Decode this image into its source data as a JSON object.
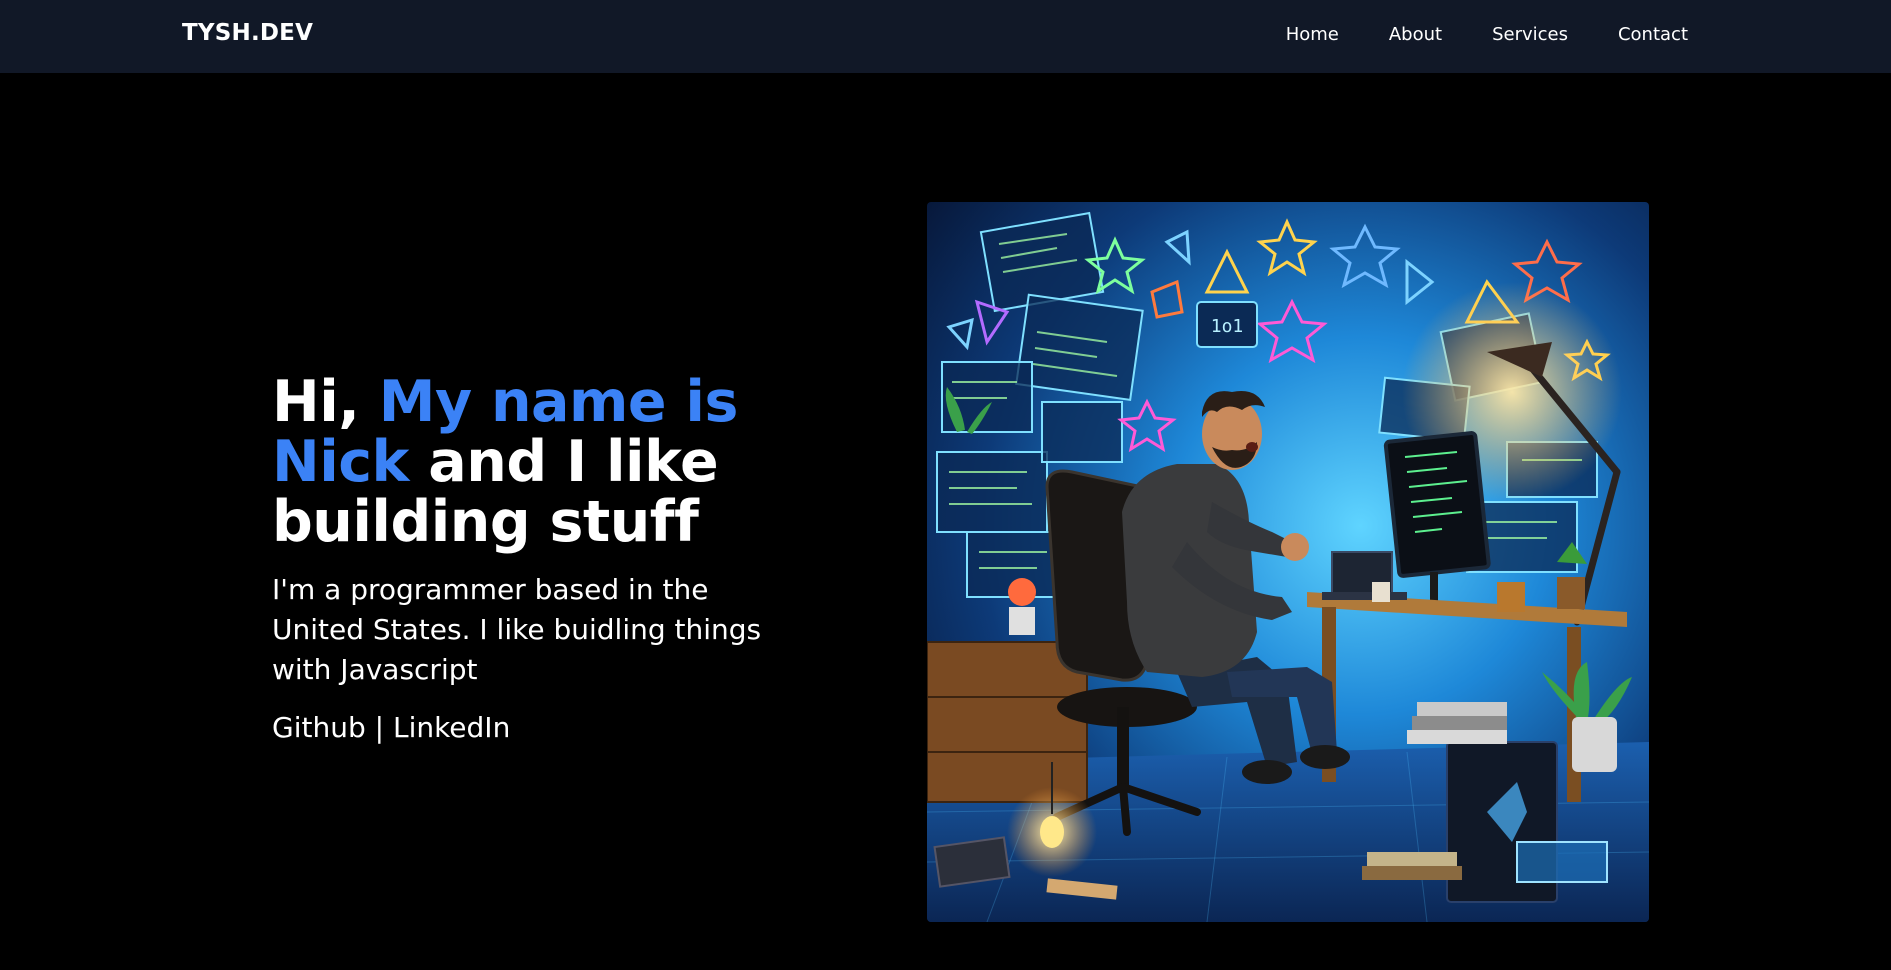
{
  "navbar": {
    "brand": "TYSH.DEV",
    "links": [
      {
        "label": "Home"
      },
      {
        "label": "About"
      },
      {
        "label": "Services"
      },
      {
        "label": "Contact"
      }
    ]
  },
  "hero": {
    "headline_part1": "Hi, ",
    "headline_accent": "My name is Nick",
    "headline_part2": " and I like building stuff",
    "intro": "I'm a programmer based in the United States. I like buidling things with Javascript",
    "social": {
      "github": "Github",
      "separator": " | ",
      "linkedin": "LinkedIn"
    },
    "image_label": "programmer-at-desk-illustration"
  },
  "colors": {
    "navbar_bg": "#111827",
    "page_bg": "#000000",
    "accent": "#3b82f6",
    "text": "#ffffff"
  }
}
